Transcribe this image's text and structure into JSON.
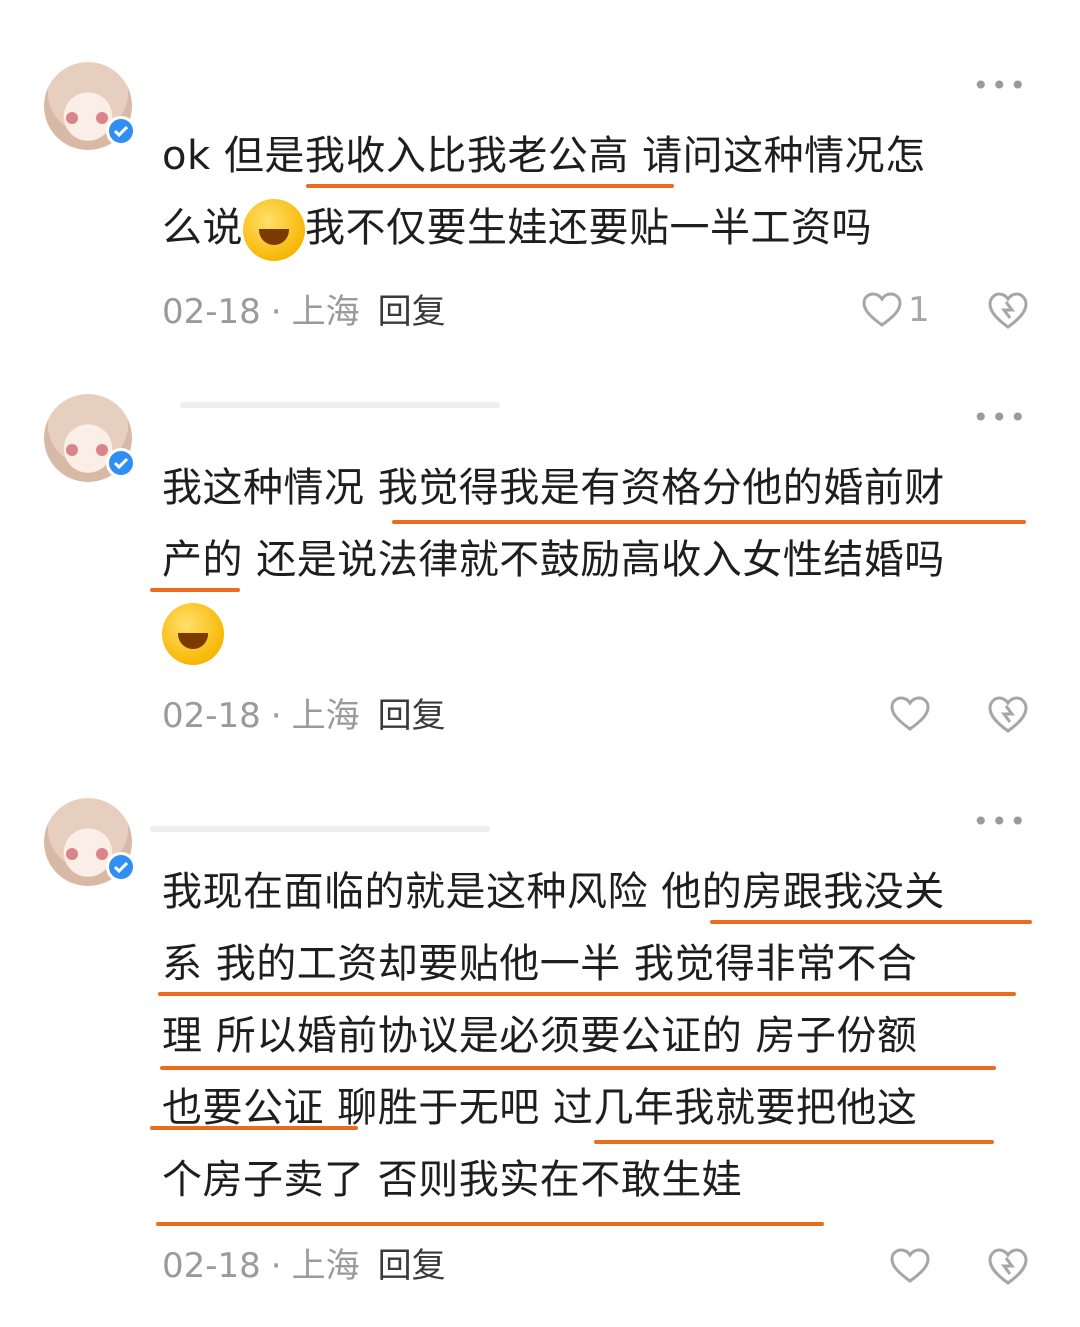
{
  "comments": [
    {
      "lines": [
        "ok 但是我收入比我老公高 请问这种情况怎",
        "么说",
        "我不仅要生娃还要贴一半工资吗"
      ],
      "date": "02-18",
      "location": "上海",
      "reply": "回复",
      "likes": "1",
      "more": "•••"
    },
    {
      "lines": [
        "我这种情况 我觉得我是有资格分他的婚前财",
        "产的 还是说法律就不鼓励高收入女性结婚吗"
      ],
      "date": "02-18",
      "location": "上海",
      "reply": "回复",
      "likes": "",
      "more": "•••"
    },
    {
      "lines": [
        "我现在面临的就是这种风险 他的房跟我没关",
        "系 我的工资却要贴他一半 我觉得非常不合",
        "理 所以婚前协议是必须要公证的 房子份额",
        "也要公证 聊胜于无吧 过几年我就要把他这",
        "个房子卖了 否则我实在不敢生娃"
      ],
      "date": "02-18",
      "location": "上海",
      "reply": "回复",
      "likes": "",
      "more": "•••"
    }
  ],
  "icons": {
    "like": "heart-outline-icon",
    "share": "share-heart-icon",
    "emoji": "facepalm-laugh-emoji"
  },
  "colors": {
    "underline": "#ec6b1d",
    "verify": "#2f8ff3",
    "meta": "#9a9a9a"
  }
}
